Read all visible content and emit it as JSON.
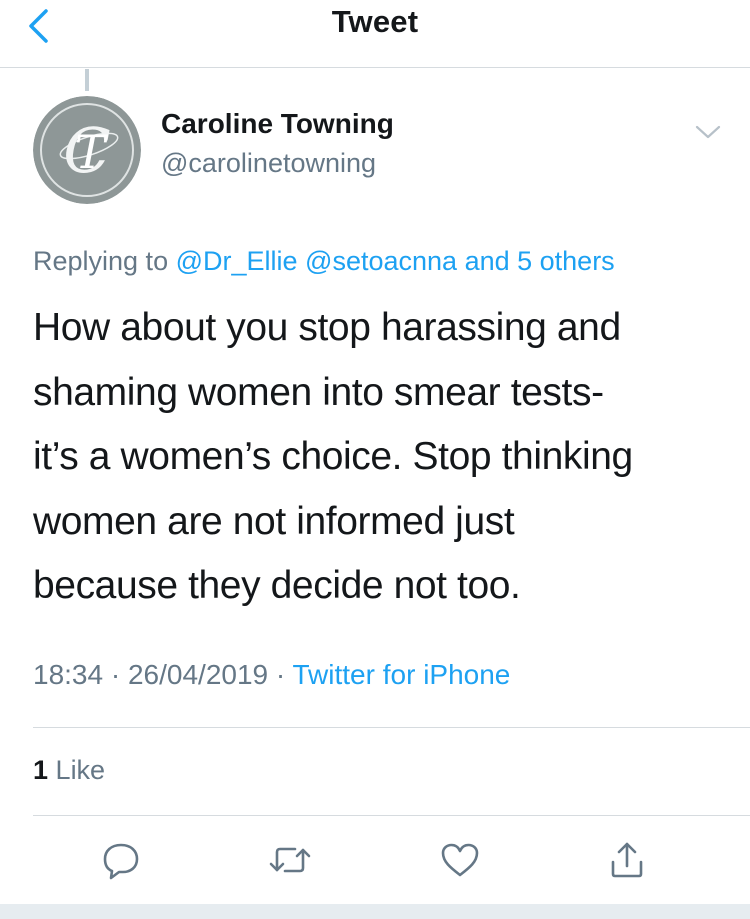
{
  "header": {
    "title": "Tweet",
    "back_icon": "chevron-left-icon"
  },
  "author": {
    "name": "Caroline Towning",
    "handle": "@carolinetowning",
    "avatar_monogram": "CT"
  },
  "reply": {
    "prefix": "Replying to ",
    "user1": "@Dr_Ellie",
    "user2": "@setoacnna",
    "others": "and 5 others"
  },
  "tweet": {
    "text": "How about you stop harassing and\nshaming women into smear tests-\nit’s a women’s choice. Stop thinking\nwomen are not informed just\nbecause they decide not too."
  },
  "meta": {
    "time": "18:34",
    "separator": " · ",
    "date": "26/04/2019",
    "source": "Twitter for iPhone"
  },
  "stats": {
    "like_count": "1",
    "like_label": "Like"
  },
  "actions": [
    "reply-icon",
    "retweet-icon",
    "like-icon",
    "share-icon"
  ],
  "colors": {
    "accent": "#1da1f2",
    "secondary_text": "#657786",
    "primary_text": "#14171a",
    "divider": "#d6dbdf"
  }
}
